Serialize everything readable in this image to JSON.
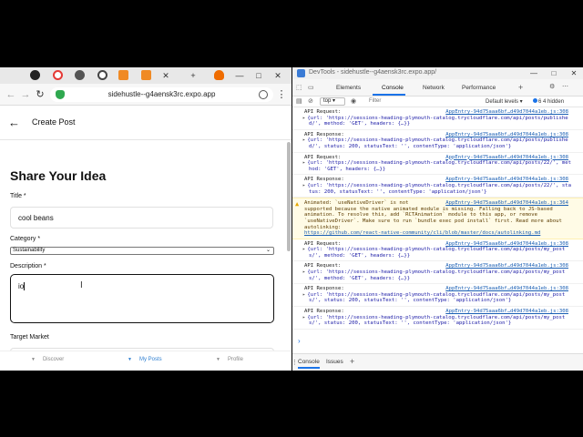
{
  "browser": {
    "url": "sidehustle--g4aensk3rc.expo.app",
    "tab_icon_colors": [
      "#222222",
      "#e53935",
      "#555555",
      "#444444",
      "#f08a24",
      "#f08a24",
      "#444444",
      "#ef6c00"
    ],
    "window_controls": [
      "—",
      "□",
      "✕"
    ]
  },
  "app": {
    "header_title": "Create Post",
    "heading": "Share Your Idea",
    "title_label": "Title *",
    "title_value": "cool beans",
    "category_label": "Category *",
    "category_value": "Sustainability",
    "description_label": "Description *",
    "description_value": "io",
    "target_market_label": "Target Market",
    "tabs": [
      {
        "label": "Discover",
        "active": false
      },
      {
        "label": "My Posts",
        "active": true
      },
      {
        "label": "Profile",
        "active": false
      }
    ],
    "accent_color": "#2f7fd1"
  },
  "devtools": {
    "title": "DevTools - sidehustle--g4aensk3rc.expo.app/",
    "tabs": [
      "Elements",
      "Console",
      "Network",
      "Performance"
    ],
    "active_tab": "Console",
    "context": "top",
    "filter_placeholder": "Filter",
    "levels": "Default levels ▾",
    "issues": "6 4 hidden",
    "logs": [
      {
        "type": "info",
        "head": "API Request:",
        "src": "AppEntry-94d75aaa6bf…d49d7044a1eb.js:308",
        "body": "{url: 'https://sessions-heading-plymouth-catalog.trycloudflare.com/api/posts/publishe d/', method: 'GET', headers: {…}}"
      },
      {
        "type": "info",
        "head": "API Response:",
        "src": "AppEntry-94d75aaa6bf…d49d7044a1eb.js:308",
        "body": "{url: 'https://sessions-heading-plymouth-catalog.trycloudflare.com/api/posts/publishe d/', status: 200, statusText: '', contentType: 'application/json'}"
      },
      {
        "type": "info",
        "head": "API Request:",
        "src": "AppEntry-94d75aaa6bf…d49d7044a1eb.js:308",
        "body": "{url: 'https://sessions-heading-plymouth-catalog.trycloudflare.com/api/posts/22/', met hod: 'GET', headers: {…}}"
      },
      {
        "type": "info",
        "head": "API Response:",
        "src": "AppEntry-94d75aaa6bf…d49d7044a1eb.js:308",
        "body": "{url: 'https://sessions-heading-plymouth-catalog.trycloudflare.com/api/posts/22/', sta tus: 200, statusText: '', contentType: 'application/json'}"
      },
      {
        "type": "warn",
        "head": "Animated: `useNativeDriver` is not",
        "src": "AppEntry-94d75aaa6bf…d49d7044a1eb.js:364",
        "body": "supported because the native animated module is missing. Falling back to JS-based animation. To resolve this, add `RCTAnimation` module to this app, or remove `useNativeDriver`. Make sure to run `bundle exec pod install` first. Read more about autolinking:",
        "link": "https://github.com/react-native-community/cli/blob/master/docs/autolinking.md"
      },
      {
        "type": "info",
        "head": "API Request:",
        "src": "AppEntry-94d75aaa6bf…d49d7044a1eb.js:308",
        "body": "{url: 'https://sessions-heading-plymouth-catalog.trycloudflare.com/api/posts/my_post s/', method: 'GET', headers: {…}}"
      },
      {
        "type": "info",
        "head": "API Request:",
        "src": "AppEntry-94d75aaa6bf…d49d7044a1eb.js:308",
        "body": "{url: 'https://sessions-heading-plymouth-catalog.trycloudflare.com/api/posts/my_post s/', method: 'GET', headers: {…}}"
      },
      {
        "type": "info",
        "head": "API Response:",
        "src": "AppEntry-94d75aaa6bf…d49d7044a1eb.js:308",
        "body": "{url: 'https://sessions-heading-plymouth-catalog.trycloudflare.com/api/posts/my_post s/', status: 200, statusText: '', contentType: 'application/json'}"
      },
      {
        "type": "info",
        "head": "API Response:",
        "src": "AppEntry-94d75aaa6bf…d49d7044a1eb.js:308",
        "body": "{url: 'https://sessions-heading-plymouth-catalog.trycloudflare.com/api/posts/my_post s/', status: 200, statusText: '', contentType: 'application/json'}"
      }
    ],
    "drawer_tabs": [
      "Console",
      "Issues"
    ]
  }
}
